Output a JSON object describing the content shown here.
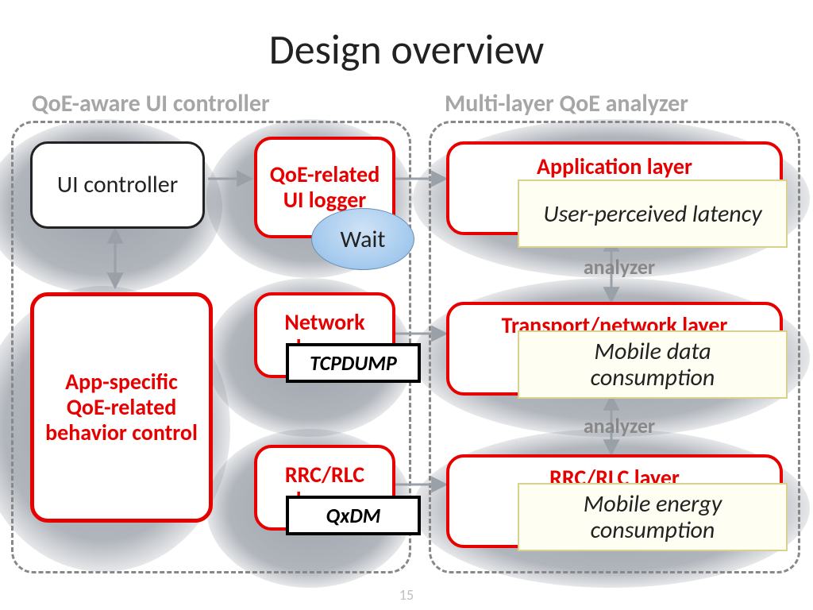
{
  "title": "Design overview",
  "sections": {
    "left_label": "QoE-aware UI controller",
    "right_label": "Multi-layer QoE analyzer"
  },
  "boxes": {
    "ui_controller": "UI controller",
    "app_specific": "App-specific QoE-related behavior control",
    "qoe_ui_logger": "QoE-related UI logger",
    "network_logger": "Network logger",
    "rrc_logger": "RRC/RLC logger",
    "app_layer": "Application layer",
    "transport_layer": "Transport/network layer",
    "rrc_layer": "RRC/RLC layer"
  },
  "analyzer_text": "analyzer",
  "notes": {
    "latency": "User-perceived latency",
    "data": "Mobile data consumption",
    "energy": "Mobile energy consumption"
  },
  "tools": {
    "tcpdump": "TCPDUMP",
    "qxdm": "QxDM"
  },
  "ellipse": "Wait",
  "slide_number": "15",
  "colors": {
    "red": "#e60000",
    "gray": "#a6a6a6",
    "blob": "#5c6673"
  }
}
